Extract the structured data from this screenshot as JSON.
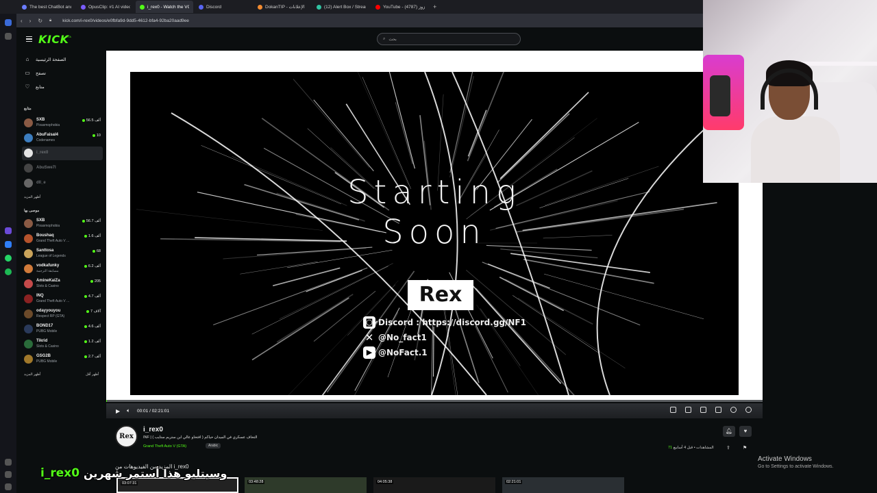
{
  "browser": {
    "tabs": [
      {
        "label": "The best ChatBot and Wri",
        "color": "#6b7cff",
        "active": false
      },
      {
        "label": "OpusClip: #1 AI video clip",
        "color": "#7a5cff",
        "active": false
      },
      {
        "label": "i_rex0 - Watch the VOD o",
        "color": "#53fc18",
        "active": true
      },
      {
        "label": "Discord",
        "color": "#5865f2",
        "active": false
      },
      {
        "label": "DokanTIP - الإعلانات",
        "color": "#f28b30",
        "active": false
      },
      {
        "label": "(12) Alert Box / Streamlabs",
        "color": "#31c3a2",
        "active": false
      },
      {
        "label": "YouTube - علي وزوز (4787)",
        "color": "#ff0000",
        "active": false
      }
    ],
    "new_tab": "+",
    "url": "kick.com/i-rex0/videos/e0fbfa9d-9dd5-4612-bfa4-92ba20aad9ee"
  },
  "header": {
    "logo": "KICK",
    "logo_badge": "BETA",
    "search_placeholder": "بحث",
    "search_icon": "search-icon"
  },
  "sidebar": {
    "nav": [
      {
        "label": "الصفحة الرئيسية",
        "icon": "home-icon"
      },
      {
        "label": "تصفح",
        "icon": "browse-icon"
      },
      {
        "label": "متابع",
        "icon": "heart-icon"
      }
    ],
    "following_heading": "متابع",
    "following": [
      {
        "name": "SXB",
        "sub": "Pixasmophobia",
        "viewers": "56.5 ألف",
        "color": "#8a5a44",
        "live": true,
        "selected": false
      },
      {
        "name": "AbuFaisal4",
        "sub": "Codenames",
        "viewers": "10",
        "color": "#3c7dbf",
        "live": true,
        "selected": false
      },
      {
        "name": "i_rex0",
        "sub": "",
        "viewers": "",
        "color": "#e4e4e4",
        "live": false,
        "selected": true
      },
      {
        "name": "AbuSwe7l",
        "sub": "",
        "viewers": "",
        "color": "#444",
        "live": false,
        "selected": false
      },
      {
        "name": "dll_e",
        "sub": "",
        "viewers": "",
        "color": "#666",
        "live": false,
        "selected": false
      }
    ],
    "show_more": "أظهر المزيد",
    "recommended_heading": "موصى بها",
    "recommended": [
      {
        "name": "SXB",
        "sub": "Pixasmophobia",
        "viewers": "56.7 ألف",
        "color": "#8a5a44"
      },
      {
        "name": "Boushaq",
        "sub": "Grand Theft Auto V ...",
        "viewers": "1.6 ألف",
        "color": "#b5532c"
      },
      {
        "name": "Santtosa",
        "sub": "League of Legends",
        "viewers": "68",
        "color": "#c9a35a"
      },
      {
        "name": "vodkafunky",
        "sub": "مسابقة الترجمة",
        "viewers": "6.2 ألف",
        "color": "#d07a3a"
      },
      {
        "name": "AmineKaiZa",
        "sub": "Slots & Casino",
        "viewers": "205",
        "color": "#c44a4a"
      },
      {
        "name": "INQ",
        "sub": "Grand Theft Auto V ...",
        "viewers": "4.7 ألف",
        "color": "#8a2222"
      },
      {
        "name": "odayyouyou",
        "sub": "Respect RP (GTA)",
        "viewers": "7 آلاف",
        "color": "#6b4a2a"
      },
      {
        "name": "BOND17",
        "sub": "PUBG Mobile",
        "viewers": "4.6 ألف",
        "color": "#2a3a5a"
      },
      {
        "name": "Tikrid",
        "sub": "Slots & Casino",
        "viewers": "1.2 ألف",
        "color": "#2a6b3a"
      },
      {
        "name": "GSG2B",
        "sub": "PUBG Mobile",
        "viewers": "2.7 ألف",
        "color": "#a0782a"
      }
    ],
    "show_more2": "أظهر المزيد",
    "show_less": "أظهر أقل"
  },
  "video": {
    "line1": "Starting",
    "line2": "Soon",
    "brand": "Rex",
    "discord": "Discord : https://discord.gg/NF1",
    "x_handle": "@No_fact1",
    "yt_handle": "@NoFact.1",
    "time_current": "00:01",
    "time_sep": "/",
    "time_total": "02:21:01",
    "progress_fraction": 0.0001
  },
  "info": {
    "avatar_text": "Rex",
    "channel_name": "i_rex0",
    "stream_title": "INF | ( افتحاو عالي ابن ستريم ستايب ) التحاف عسكري في الميدان حياكم",
    "category": "Grand Theft Auto V (GTA)",
    "language": "Arabic",
    "posted": "قبل 4 أسابيع",
    "dot": "•",
    "views_label": "المشاهدات",
    "views_value": "71",
    "more_videos": "المزيد من الفيديوهات من i_rex0"
  },
  "thumbs": [
    {
      "duration": "03:07:31"
    },
    {
      "duration": "03:48:28"
    },
    {
      "duration": "04:05:38"
    },
    {
      "duration": "02:21:01"
    }
  ],
  "overlay": {
    "name": "i_rex0",
    "text": "وسيتليو هذا أستمر شهرين"
  },
  "windows": {
    "activate": "Activate Windows",
    "activate_sub": "Go to Settings to activate Windows."
  }
}
